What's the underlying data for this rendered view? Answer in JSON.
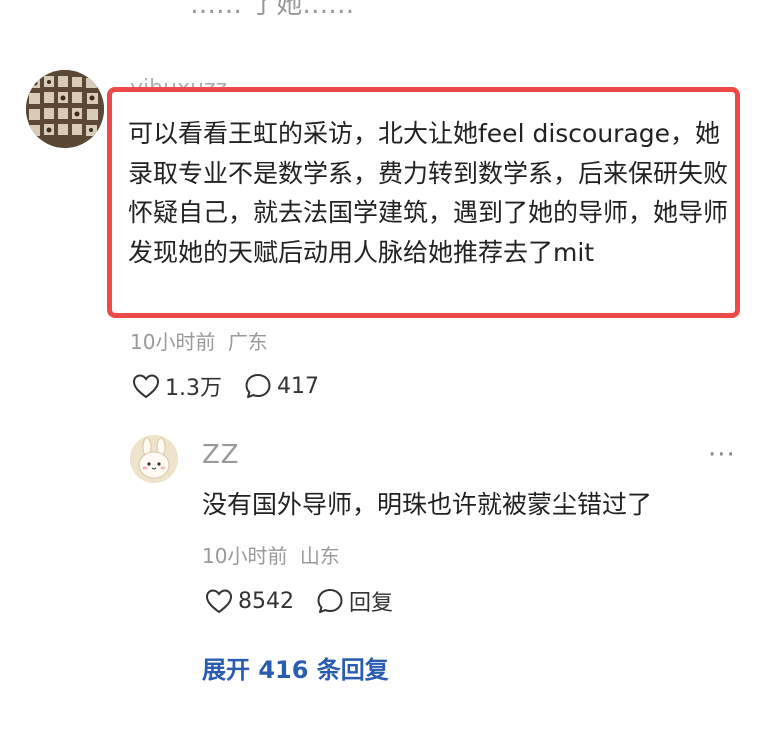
{
  "top_partial_text": "…… 了她……",
  "main_comment": {
    "username": "yihuxuzz",
    "text": "可以看看王虹的采访，北大让她feel discourage，她录取专业不是数学系，费力转到数学系，后来保研失败怀疑自己，就去法国学建筑，遇到了她的导师，她导师发现她的天赋后动用人脉给她推荐去了mit",
    "time": "10小时前",
    "location": "广东",
    "like_count": "1.3万",
    "comment_count": "417",
    "highlight_color": "#ee4a4a"
  },
  "reply": {
    "username": "ZZ",
    "more_label": "···",
    "text": "没有国外导师，明珠也许就被蒙尘错过了",
    "time": "10小时前",
    "location": "山东",
    "like_count": "8542",
    "reply_label": "回复"
  },
  "expand": {
    "label": "展开 416 条回复"
  },
  "colors": {
    "link": "#2a5db0",
    "meta": "#9a9a9a"
  }
}
